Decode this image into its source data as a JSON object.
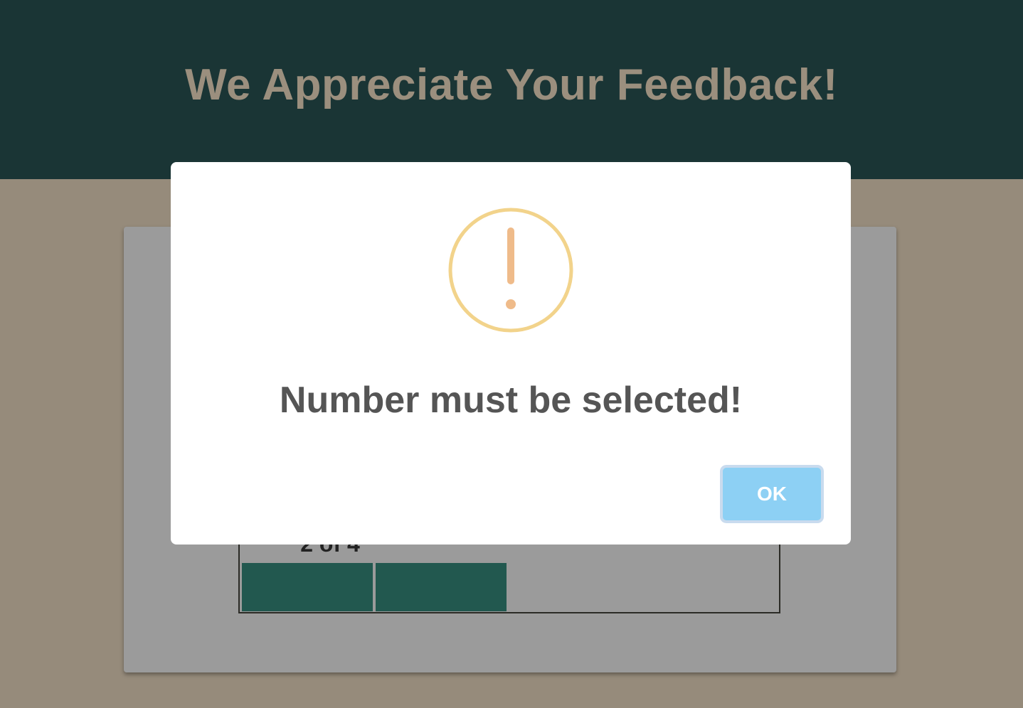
{
  "header": {
    "title": "We Appreciate Your Feedback!"
  },
  "survey": {
    "progress_label": "2 of 4",
    "progress_current": 2,
    "progress_total": 4
  },
  "dialog": {
    "icon": "warning-icon",
    "message": "Number must be selected!",
    "ok_label": "OK"
  },
  "colors": {
    "header_bg": "#1a3535",
    "page_bg": "#968b7b",
    "title_color": "#9b8f7e",
    "progress_fill": "#22584f",
    "warning_ring": "#f2d38b",
    "warning_mark": "#efbb8a",
    "ok_button": "#8dd0f4"
  }
}
